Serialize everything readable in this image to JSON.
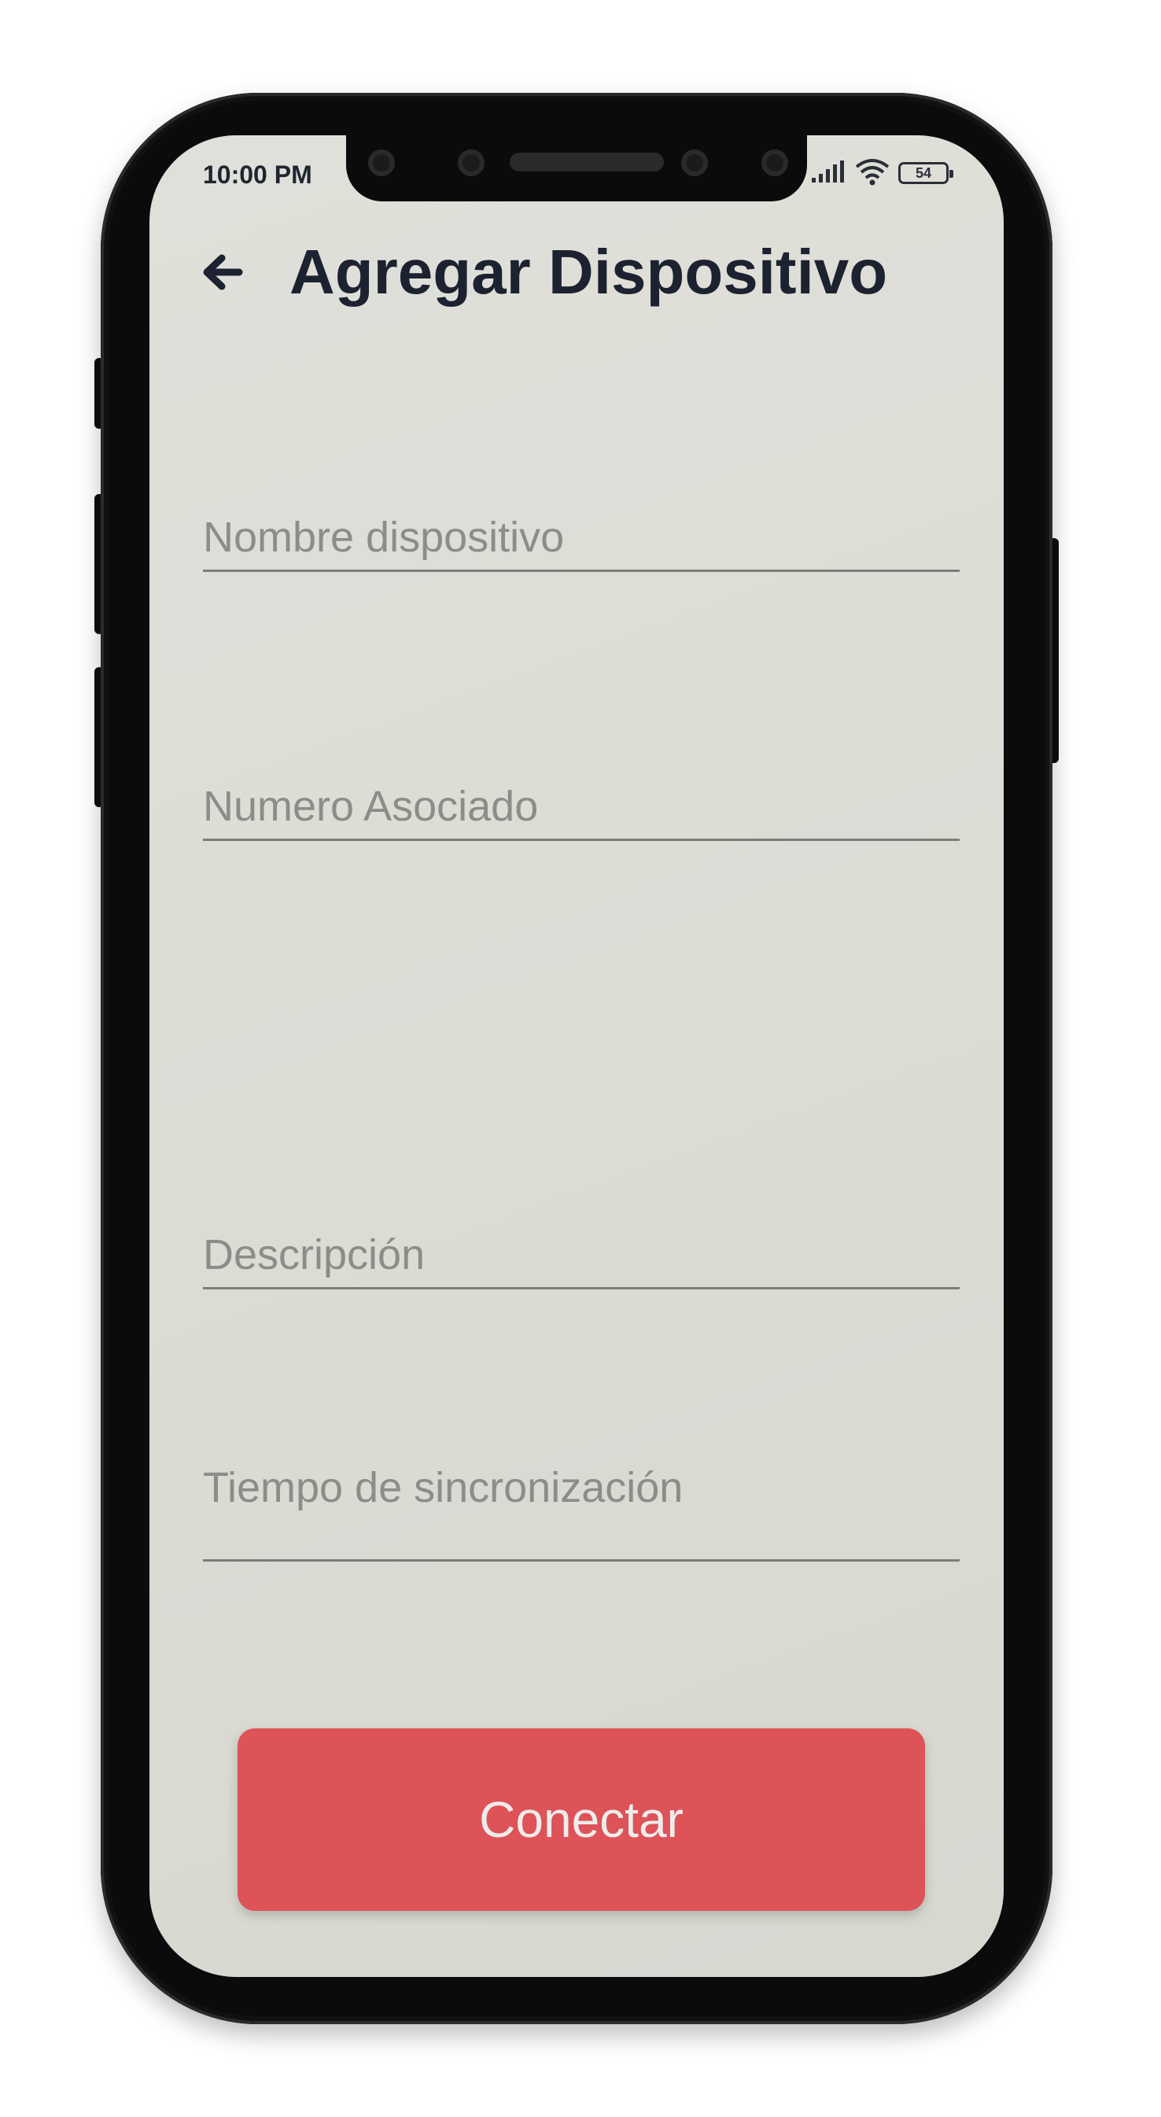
{
  "status_bar": {
    "time": "10:00 PM",
    "battery": "54",
    "icons": [
      "signal-icon",
      "wifi-icon",
      "battery-icon"
    ]
  },
  "header": {
    "back_icon": "arrow-left-icon",
    "title": "Agregar Dispositivo"
  },
  "form": {
    "device_name": {
      "placeholder": "Nombre dispositivo",
      "value": ""
    },
    "associated_number": {
      "placeholder": "Numero Asociado",
      "value": ""
    },
    "description": {
      "placeholder": "Descripción",
      "value": ""
    },
    "sync_time": {
      "placeholder": "Tiempo de sincronización",
      "value": ""
    }
  },
  "actions": {
    "connect_label": "Conectar"
  },
  "colors": {
    "accent": "#dd5357",
    "title_text": "#1c2230",
    "screen_bg": "#dcdcd5",
    "placeholder": "#8c8c88"
  }
}
